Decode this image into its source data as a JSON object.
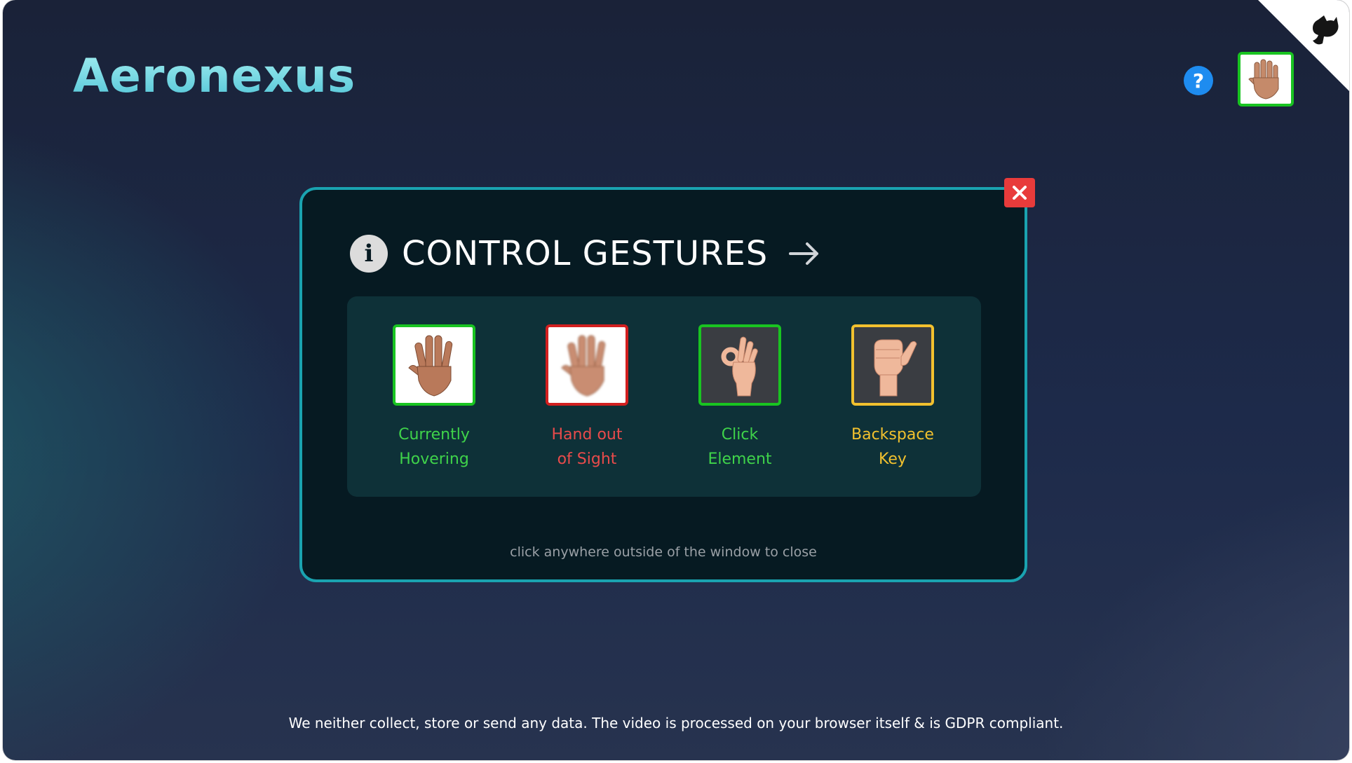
{
  "app": {
    "logo": "Aeronexus",
    "help_label": "?",
    "footer": "We neither collect, store or send any data. The video is processed on your browser itself & is GDPR compliant.",
    "camera_border_color": "#19c421"
  },
  "modal": {
    "title": "CONTROL GESTURES",
    "info_glyph": "i",
    "close_icon": "close-icon",
    "hint": "click anywhere outside of the window to close",
    "gestures": [
      {
        "line1": "Currently",
        "line2": "Hovering",
        "color": "#3fd34a",
        "icon": "open-palm-icon"
      },
      {
        "line1": "Hand out",
        "line2": "of Sight",
        "color": "#e94b4b",
        "icon": "blurred-palm-icon"
      },
      {
        "line1": "Click",
        "line2": "Element",
        "color": "#3fd34a",
        "icon": "ok-hand-icon"
      },
      {
        "line1": "Backspace",
        "line2": "Key",
        "color": "#f2c12e",
        "icon": "thumbs-hand-icon"
      }
    ]
  }
}
